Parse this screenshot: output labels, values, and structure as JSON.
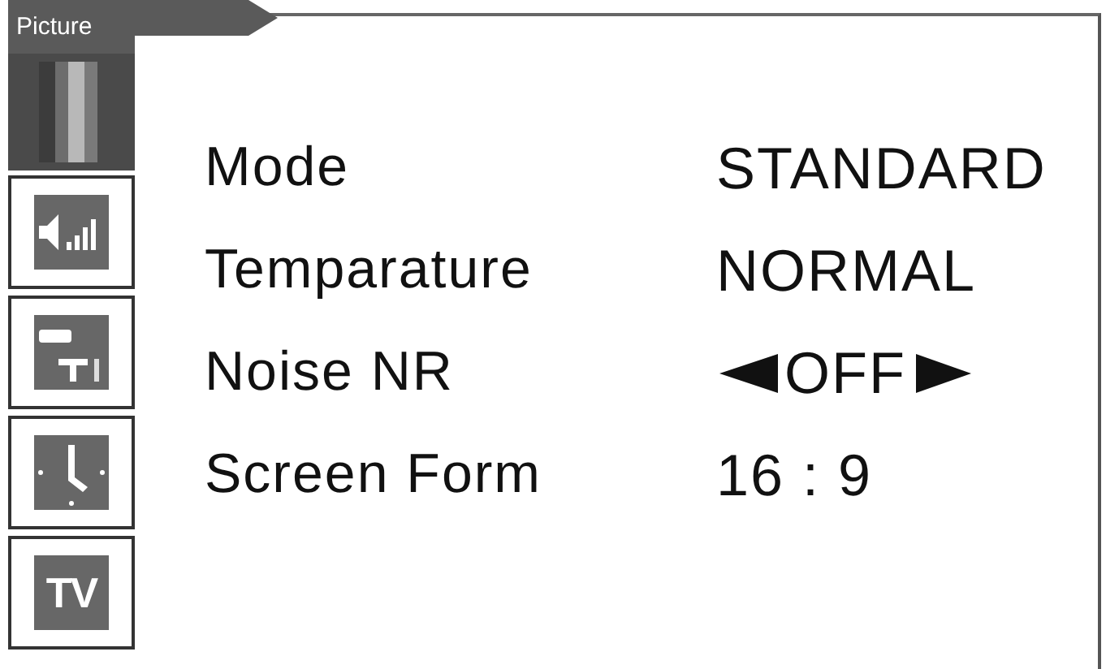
{
  "menu_title": "Picture",
  "sidebar": {
    "items": [
      {
        "kind": "picture",
        "selected": true
      },
      {
        "kind": "sound",
        "selected": false
      },
      {
        "kind": "setup",
        "selected": false
      },
      {
        "kind": "clock",
        "selected": false
      },
      {
        "kind": "tv",
        "label": "TV",
        "selected": false
      }
    ]
  },
  "settings": [
    {
      "label": "Mode",
      "value": "STANDARD",
      "selected": false
    },
    {
      "label": "Temparature",
      "value": "NORMAL",
      "selected": false
    },
    {
      "label": "Noise NR",
      "value": "OFF",
      "selected": true
    },
    {
      "label": "Screen Form",
      "value": "16 : 9",
      "selected": false
    }
  ]
}
